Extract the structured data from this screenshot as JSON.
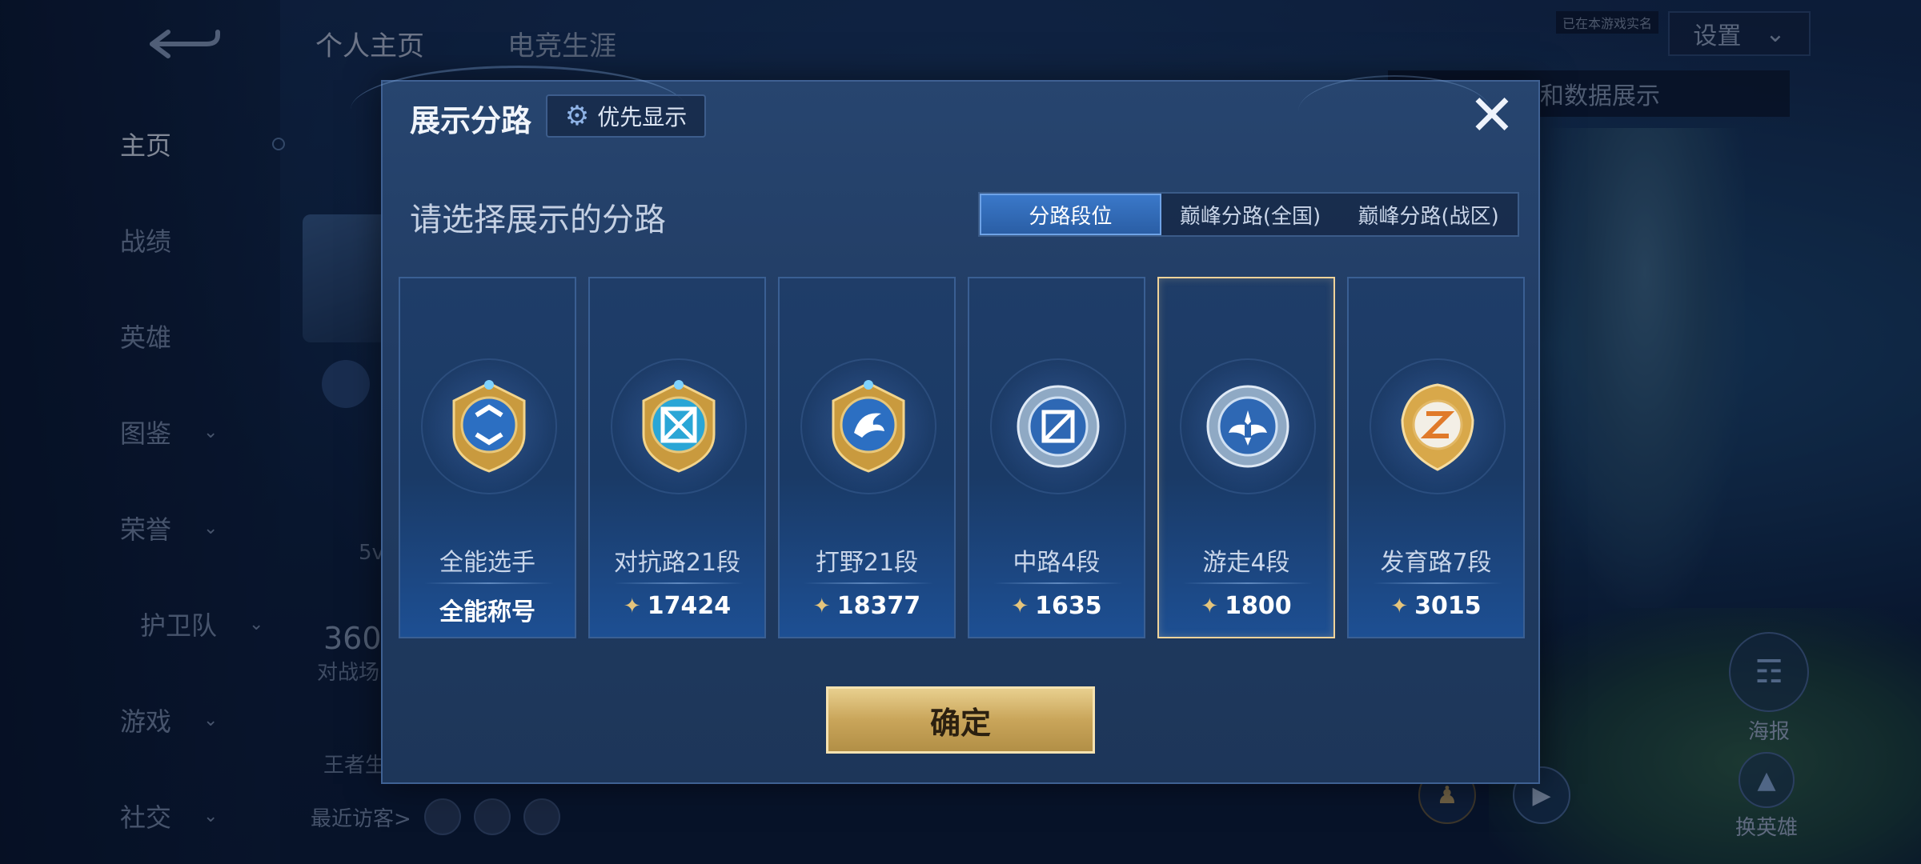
{
  "background": {
    "sidebar": {
      "items": [
        {
          "label": "主页",
          "active": true,
          "expandable": false
        },
        {
          "label": "战绩",
          "active": false,
          "expandable": false
        },
        {
          "label": "英雄",
          "active": false,
          "expandable": false
        },
        {
          "label": "图鉴",
          "active": false,
          "expandable": true
        },
        {
          "label": "荣誉",
          "active": false,
          "expandable": true
        },
        {
          "label": "护卫队",
          "active": false,
          "expandable": true
        },
        {
          "label": "游戏",
          "active": false,
          "expandable": true
        },
        {
          "label": "社交",
          "active": false,
          "expandable": true
        }
      ]
    },
    "tabs": {
      "personal": "个人主页",
      "career": "电竞生涯"
    },
    "profile": {
      "level_text": "5v",
      "stat_value": "360",
      "stat_label": "对战场",
      "honor_label": "王者生"
    },
    "visitors_label": "最近访客>",
    "settings_label": "设置",
    "realname_tag": "已在本游戏实名",
    "tip_text": "以切换灵宝和数据展示",
    "poster_label": "海报",
    "switch_hero_label": "换英雄"
  },
  "modal": {
    "title": "展示分路",
    "priority_label": "优先显示",
    "subtitle": "请选择展示的分路",
    "segments": [
      {
        "label": "分路段位",
        "active": true
      },
      {
        "label": "巅峰分路(全国)",
        "active": false
      },
      {
        "label": "巅峰分路(战区)",
        "active": false
      }
    ],
    "cards": [
      {
        "name": "全能选手",
        "score": "全能称号",
        "has_mark": false,
        "selected": false
      },
      {
        "name": "对抗路21段",
        "score": "17424",
        "has_mark": true,
        "selected": false
      },
      {
        "name": "打野21段",
        "score": "18377",
        "has_mark": true,
        "selected": false
      },
      {
        "name": "中路4段",
        "score": "1635",
        "has_mark": true,
        "selected": false
      },
      {
        "name": "游走4段",
        "score": "1800",
        "has_mark": true,
        "selected": true
      },
      {
        "name": "发育路7段",
        "score": "3015",
        "has_mark": true,
        "selected": false
      }
    ],
    "confirm_label": "确定"
  },
  "colors": {
    "modal_bg": "#213c64",
    "accent_blue": "#3a78c9",
    "gold": "#c9a55a",
    "selected_border": "#f0d39a"
  }
}
